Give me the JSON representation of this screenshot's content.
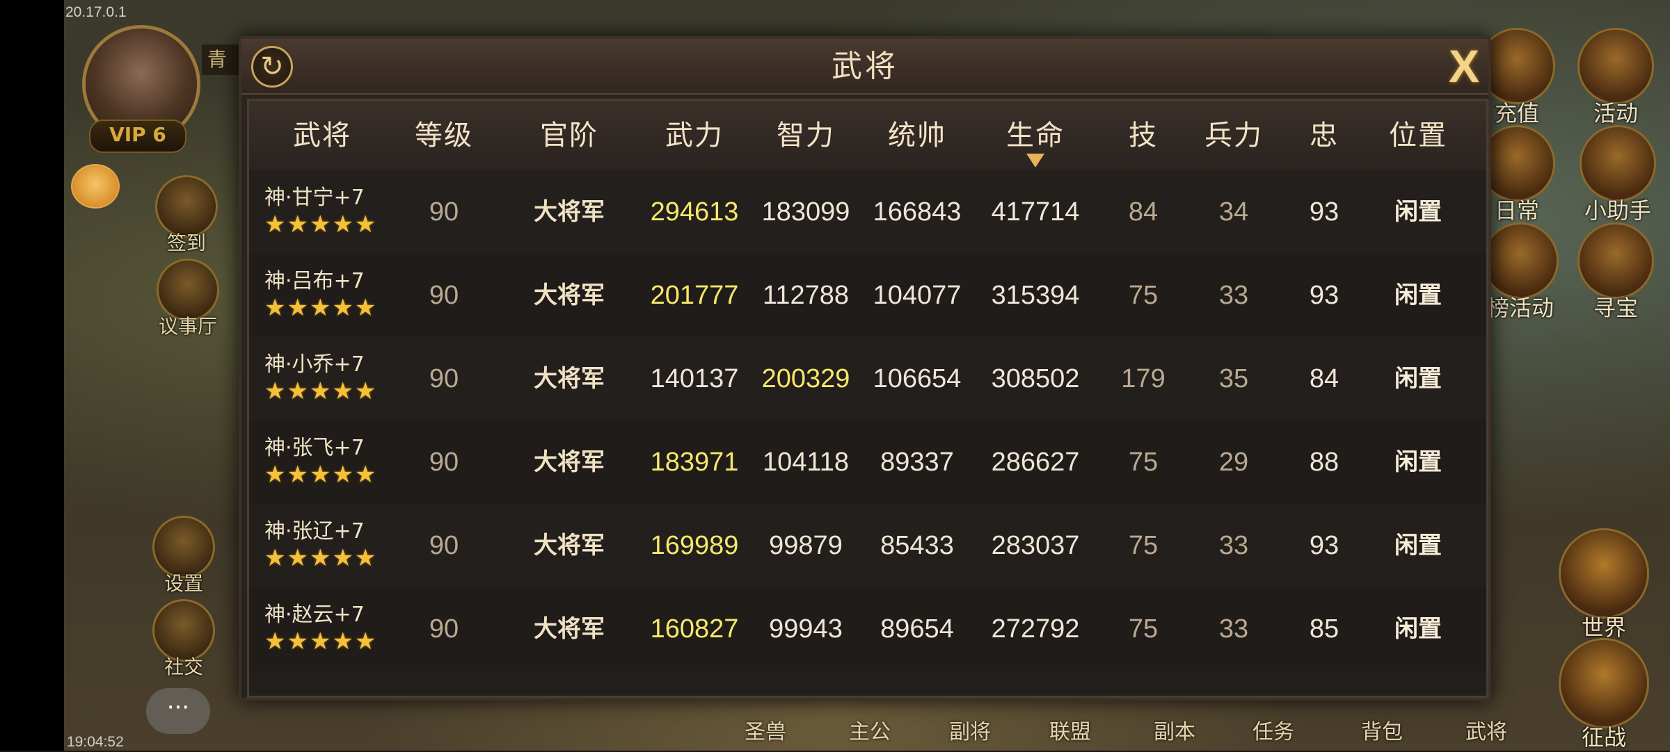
{
  "status": {
    "ip": "20.17.0.1",
    "clock": "19:04:52"
  },
  "player": {
    "vip": "VIP 6",
    "name_fragment": "青"
  },
  "left_menu": [
    {
      "label": "签到"
    },
    {
      "label": "议事厅"
    },
    {
      "label": "设置"
    },
    {
      "label": "社交"
    }
  ],
  "right_menu": [
    {
      "label": "充值"
    },
    {
      "label": "活动"
    },
    {
      "label": "日常"
    },
    {
      "label": "小助手"
    },
    {
      "label": "榜活动"
    },
    {
      "label": "寻宝"
    },
    {
      "label": "世界"
    },
    {
      "label": "征战"
    }
  ],
  "chat": {
    "label": "···"
  },
  "bottom_menu": [
    "圣兽",
    "主公",
    "副将",
    "联盟",
    "副本",
    "任务",
    "背包",
    "武将"
  ],
  "modal": {
    "title": "武将",
    "close_label": "X",
    "refresh_label": "↻",
    "columns": [
      "武将",
      "等级",
      "官阶",
      "武力",
      "智力",
      "统帅",
      "生命",
      "技",
      "兵力",
      "忠",
      "位置"
    ],
    "sorted_by": "生命",
    "rows": [
      {
        "name": "神·甘宁+7",
        "stars": "★★★★★",
        "level": "90",
        "rank": "大将军",
        "force": "294613",
        "intel": "183099",
        "command": "166843",
        "life": "417714",
        "skill": "84",
        "troops": "34",
        "loyalty": "93",
        "position": "闲置",
        "highlight": "force"
      },
      {
        "name": "神·吕布+7",
        "stars": "★★★★★",
        "level": "90",
        "rank": "大将军",
        "force": "201777",
        "intel": "112788",
        "command": "104077",
        "life": "315394",
        "skill": "75",
        "troops": "33",
        "loyalty": "93",
        "position": "闲置",
        "highlight": "force"
      },
      {
        "name": "神·小乔+7",
        "stars": "★★★★★",
        "level": "90",
        "rank": "大将军",
        "force": "140137",
        "intel": "200329",
        "command": "106654",
        "life": "308502",
        "skill": "179",
        "troops": "35",
        "loyalty": "84",
        "position": "闲置",
        "highlight": "intel"
      },
      {
        "name": "神·张飞+7",
        "stars": "★★★★★",
        "level": "90",
        "rank": "大将军",
        "force": "183971",
        "intel": "104118",
        "command": "89337",
        "life": "286627",
        "skill": "75",
        "troops": "29",
        "loyalty": "88",
        "position": "闲置",
        "highlight": "force"
      },
      {
        "name": "神·张辽+7",
        "stars": "★★★★★",
        "level": "90",
        "rank": "大将军",
        "force": "169989",
        "intel": "99879",
        "command": "85433",
        "life": "283037",
        "skill": "75",
        "troops": "33",
        "loyalty": "93",
        "position": "闲置",
        "highlight": "force"
      },
      {
        "name": "神·赵云+7",
        "stars": "★★★★★",
        "level": "90",
        "rank": "大将军",
        "force": "160827",
        "intel": "99943",
        "command": "89654",
        "life": "272792",
        "skill": "75",
        "troops": "33",
        "loyalty": "85",
        "position": "闲置",
        "highlight": "force"
      }
    ]
  }
}
